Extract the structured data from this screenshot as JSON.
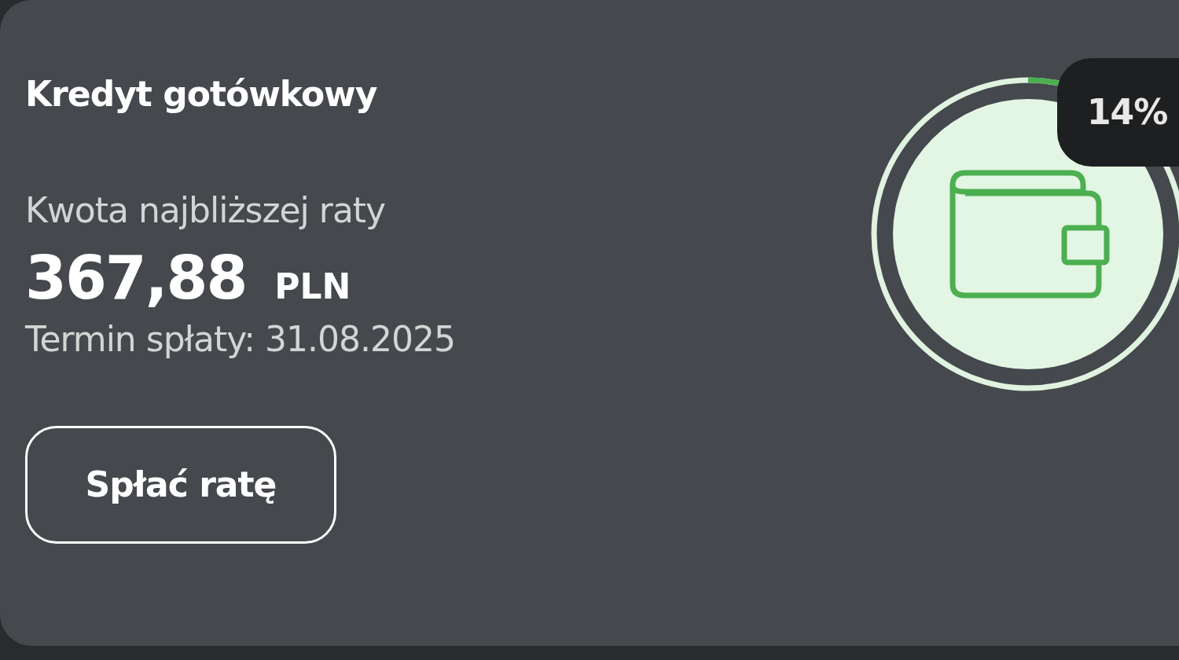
{
  "loan": {
    "title": "Kredyt gotówkowy",
    "installment_label": "Kwota najbliższej raty",
    "amount": "367,88",
    "currency": "PLN",
    "due_date": "Termin spłaty: 31.08.2025",
    "pay_button": "Spłać ratę"
  },
  "progress": {
    "label": "14%"
  }
}
